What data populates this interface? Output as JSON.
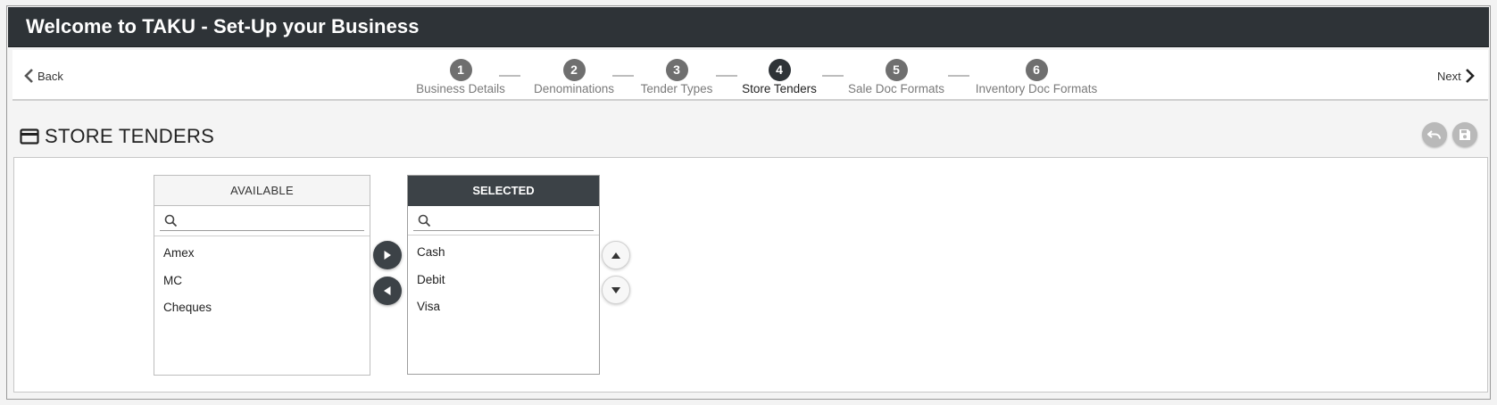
{
  "header": {
    "title": "Welcome to TAKU - Set-Up your Business"
  },
  "nav": {
    "back_label": "Back",
    "next_label": "Next"
  },
  "steps": [
    {
      "num": "1",
      "label": "Business Details"
    },
    {
      "num": "2",
      "label": "Denominations"
    },
    {
      "num": "3",
      "label": "Tender Types"
    },
    {
      "num": "4",
      "label": "Store Tenders",
      "active": true
    },
    {
      "num": "5",
      "label": "Sale Doc Formats"
    },
    {
      "num": "6",
      "label": "Inventory Doc Formats"
    }
  ],
  "section": {
    "title": "STORE TENDERS",
    "icon": "credit-card-icon"
  },
  "toolbar": {
    "undo_icon": "undo-icon",
    "save_icon": "save-icon"
  },
  "available": {
    "header": "AVAILABLE",
    "search_placeholder": "",
    "items": [
      "Amex",
      "MC",
      "Cheques"
    ]
  },
  "selected": {
    "header": "SELECTED",
    "search_placeholder": "",
    "items": [
      "Cash",
      "Debit",
      "Visa"
    ]
  },
  "colors": {
    "titlebar": "#2e3337",
    "active_step": "#2e3337",
    "inactive_step": "#6f6f6f"
  }
}
